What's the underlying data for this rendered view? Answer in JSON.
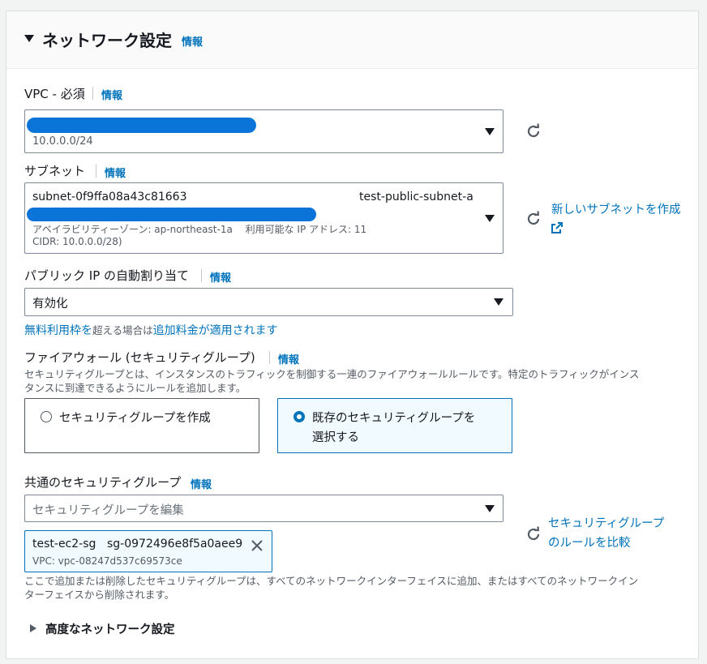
{
  "header": {
    "title": "ネットワーク設定",
    "info": "情報"
  },
  "vpc": {
    "label": "VPC - 必須",
    "info": "情報",
    "cidr": "10.0.0.0/24"
  },
  "subnet": {
    "label": "サブネット",
    "info": "情報",
    "id": "subnet-0f9ffa08a43c81663",
    "name": "test-public-subnet-a",
    "detail1": "アベイラビリティーゾーン: ap-northeast-1a　 利用可能な IP アドレス: 11",
    "detail2": "CIDR: 10.0.0.0/28)",
    "create_link": "新しいサブネットを作成"
  },
  "public_ip": {
    "label": "パブリック IP の自動割り当て",
    "info": "情報",
    "value": "有効化",
    "note_a": "無料利用枠を",
    "note_b": "超える場合は",
    "note_c": "追加料金が適用されます"
  },
  "firewall": {
    "label": "ファイアウォール (セキュリティグループ)",
    "info": "情報",
    "desc1": "セキュリティグループとは、インスタンスのトラフィックを制御する一連のファイアウォールルールです。特定のトラフィックがインス",
    "desc2": "タンスに到達できるようにルールを追加します。",
    "option_create": "セキュリティグループを作成",
    "option_existing_1": "既存のセキュリティグループを",
    "option_existing_2": "選択する"
  },
  "common_sg": {
    "label": "共通のセキュリティグループ",
    "info": "情報",
    "placeholder": "セキュリティグループを編集",
    "token_name": "test-ec2-sg",
    "token_id": "sg-0972496e8f5a0aee9",
    "token_vpc": "VPC: vpc-08247d537c69573ce",
    "compare_link_1": "セキュリティグループ",
    "compare_link_2": "のルールを比較",
    "desc1": "ここで追加または削除したセキュリティグループは、すべてのネットワークインターフェイスに追加、またはすべてのネットワークイン",
    "desc2": "ターフェイスから削除されます。"
  },
  "advanced": {
    "label": "高度なネットワーク設定"
  },
  "icons": [
    "caret-down-icon",
    "dropdown-arrow-icon",
    "refresh-icon",
    "external-link-icon",
    "close-icon",
    "caret-right-icon"
  ],
  "colors": {
    "accent": "#0073bb",
    "redaction": "#0a74d8"
  }
}
